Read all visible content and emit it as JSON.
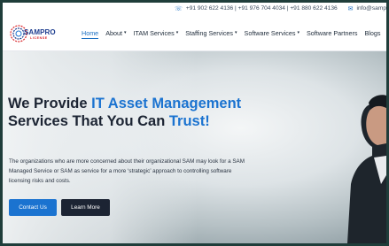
{
  "topbar": {
    "phone_text": "+91 902 622 4136 | +91 976 704 4034 | +91 880 622 4136",
    "email_text": "info@samp",
    "phone_icon": "phone-icon",
    "mail_icon": "mail-icon"
  },
  "logo": {
    "brand_main": "SAMPRO",
    "brand_sub": "LICENSE"
  },
  "nav": {
    "items": [
      {
        "label": "Home",
        "active": true,
        "dropdown": false
      },
      {
        "label": "About",
        "dropdown": true
      },
      {
        "label": "ITAM Services",
        "dropdown": true
      },
      {
        "label": "Staffing Services",
        "dropdown": true
      },
      {
        "label": "Software Services",
        "dropdown": true
      },
      {
        "label": "Software Partners",
        "dropdown": false
      },
      {
        "label": "Blogs",
        "dropdown": false
      }
    ],
    "chevron": "⌄"
  },
  "hero": {
    "headline_part1": "We Provide ",
    "headline_highlight1": "IT Asset Management",
    "headline_part2": " Services That You Can ",
    "headline_highlight2": "Trust!",
    "description": "The organizations who are more concerned about their organizational SAM may look for a SAM Managed Service or SAM as service for a more ‘strategic’ approach to controlling software licensing risks and costs.",
    "contact_button": "Contact Us",
    "learn_button": "Learn More"
  },
  "colors": {
    "accent": "#1b73d0",
    "dark": "#1c2433",
    "frame": "#1f3d3a"
  }
}
